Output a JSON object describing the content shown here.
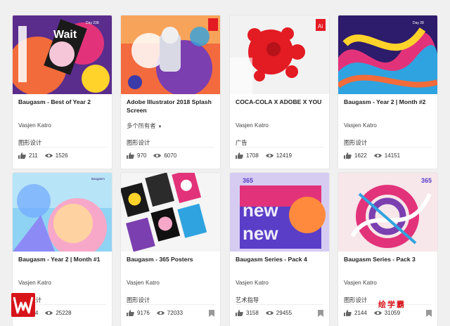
{
  "cards": [
    {
      "title": "Baugasm - Best of Year 2",
      "owner": "Vasjen Katro",
      "field": "图形设计",
      "likes": "211",
      "views": "1526"
    },
    {
      "title": "Adobe Illustrator 2018 Splash Screen",
      "owner": "多个所有者",
      "field": "图形设计",
      "likes": "970",
      "views": "6070"
    },
    {
      "title": "COCA-COLA X ADOBE X YOU",
      "owner": "Vasjen Katro",
      "field": "广告",
      "likes": "1708",
      "views": "12419"
    },
    {
      "title": "Baugasm - Year 2 | Month #2",
      "owner": "Vasjen Katro",
      "field": "图形设计",
      "likes": "1622",
      "views": "14151"
    },
    {
      "title": "Baugasm - Year 2 | Month #1",
      "owner": "Vasjen Katro",
      "field": "图形设计",
      "likes": "264",
      "views": "25228"
    },
    {
      "title": "Baugasm - 365 Posters",
      "owner": "Vasjen Katro",
      "field": "图形设计",
      "likes": "9176",
      "views": "72033"
    },
    {
      "title": "Baugasm Series - Pack 4",
      "owner": "Vasjen Katro",
      "field": "艺术指导",
      "likes": "3158",
      "views": "29455"
    },
    {
      "title": "Baugasm Series - Pack 3",
      "owner": "Vasjen Katro",
      "field": "图形设计",
      "likes": "2144",
      "views": "31059"
    }
  ],
  "thumb_text": {
    "c1_a": "Wait",
    "c1_b": "Day 238",
    "c3_a": "Ai",
    "c4_a": "Day 28",
    "c5_a": "Baugasm",
    "c7_a": "365",
    "c7_b": "new",
    "c7_c": "new",
    "c8_a": "365"
  },
  "watermark": {
    "logo": "W",
    "text": "绘学霸"
  },
  "colors": {
    "accent": "#d7141a",
    "card_bg": "#ffffff",
    "page_bg": "#f0f0f0"
  },
  "icons": {
    "like": "thumbs-up-icon",
    "view": "eye-icon",
    "save": "bookmark-icon"
  }
}
